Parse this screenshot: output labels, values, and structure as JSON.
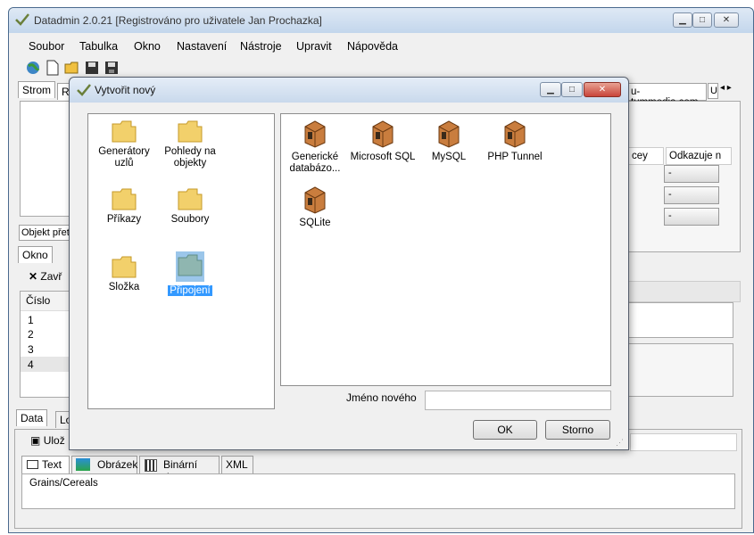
{
  "main": {
    "title": "Datadmin 2.0.21 [Registrováno pro uživatele Jan Prochazka]",
    "menu": [
      "Soubor",
      "Tabulka",
      "Okno",
      "Nastavení",
      "Nástroje",
      "Upravit",
      "Nápověda"
    ],
    "left_tabs": [
      "Strom",
      "Ro"
    ],
    "object_header": "Objekt přet",
    "okno_tab": "Okno",
    "close_label": "Zavř",
    "cislo_header": "Číslo",
    "rows": [
      "1",
      "2",
      "3",
      "4"
    ],
    "right_tab_label": "u-tummedia.com",
    "right_tab_partial": "U",
    "col_key": "cey",
    "col_ref": "Odkazuje n",
    "dash": "-",
    "data_tab": "Data",
    "lo_tab": "Lo",
    "save_label": "Ulož",
    "subtabs": [
      "Text",
      "Obrázek",
      "Binární data",
      "XML"
    ],
    "text_value": "Grains/Cereals"
  },
  "dialog": {
    "title": "Vytvořit nový",
    "folders": [
      {
        "label": "Generátory uzlů"
      },
      {
        "label": "Pohledy na objekty"
      },
      {
        "label": "Příkazy"
      },
      {
        "label": "Soubory"
      },
      {
        "label": "Složka"
      },
      {
        "label": "Připojení"
      }
    ],
    "items": [
      {
        "label": "Generické databázo..."
      },
      {
        "label": "Microsoft SQL"
      },
      {
        "label": "MySQL"
      },
      {
        "label": "PHP Tunnel"
      },
      {
        "label": "SQLite"
      }
    ],
    "name_label": "Jméno nového",
    "name_value": "",
    "ok": "OK",
    "cancel": "Storno"
  },
  "colors": {
    "folder": "#f2d06b",
    "db": "#c97d3e",
    "accent": "#3399ff"
  }
}
